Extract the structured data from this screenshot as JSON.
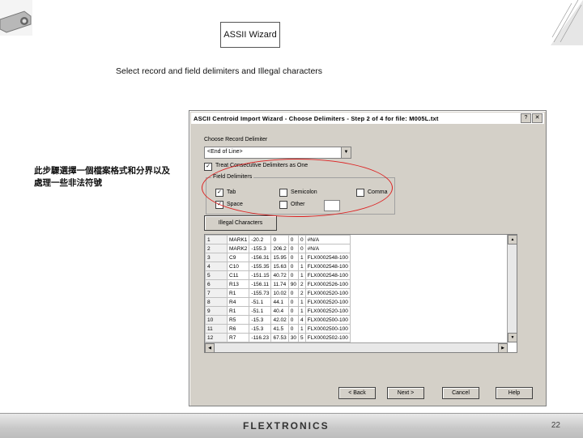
{
  "slide": {
    "title": "ASSII Wizard",
    "subtitle": "Select record and field delimiters and Illegal characters",
    "annotation": "此步驟選擇一個檔案格式和分界以及處理一些非法符號",
    "footer_logo": "FLEXTRONICS",
    "page_number": "22",
    "highlight_color": "#dd2222"
  },
  "dialog": {
    "title": "ASCII Centroid Import Wizard - Choose Delimiters - Step 2 of 4 for file: M005L.txt",
    "help_btn": "?",
    "close_btn": "✕",
    "record_delimiter_label": "Choose Record Delimiter",
    "record_delimiter_value": "<End of Line>",
    "treat_consecutive_label": "Treat Consecutive Delimiters as One",
    "treat_consecutive_checked": "✓",
    "field_delimiters_label": "Field Delimiters",
    "delims": {
      "tab": {
        "label": "Tab",
        "mark": "✓"
      },
      "semicolon": {
        "label": "Semicolon",
        "mark": ""
      },
      "comma": {
        "label": "Comma",
        "mark": ""
      },
      "space": {
        "label": "Space",
        "mark": "✓"
      },
      "other": {
        "label": "Other",
        "mark": ""
      }
    },
    "illegal_chars_btn": "Illegal Characters",
    "table": {
      "rows": [
        [
          "1",
          "MARK1",
          "-20.2",
          "0",
          "0",
          "0",
          "#N/A"
        ],
        [
          "2",
          "MARK2",
          "-155.3",
          "206.2",
          "0",
          "0",
          "#N/A"
        ],
        [
          "3",
          "C9",
          "-156.31",
          "15.95",
          "0",
          "1",
          "FLX0002548-100"
        ],
        [
          "4",
          "C10",
          "-155.35",
          "15.63",
          "0",
          "1",
          "FLX0002548-100"
        ],
        [
          "5",
          "C11",
          "-151.15",
          "40.72",
          "0",
          "1",
          "FLX0002548-100"
        ],
        [
          "6",
          "R13",
          "-156.11",
          "11.74",
          "90",
          "2",
          "FLX0002526-100"
        ],
        [
          "7",
          "R1",
          "-155.73",
          "10.02",
          "0",
          "2",
          "FLX0002520-100"
        ],
        [
          "8",
          "R4",
          "-51.1",
          "44.1",
          "0",
          "1",
          "FLX0002520-100"
        ],
        [
          "9",
          "R1",
          "-51.1",
          "40.4",
          "0",
          "1",
          "FLX0002520-100"
        ],
        [
          "10",
          "R5",
          "-15.3",
          "42.02",
          "0",
          "4",
          "FLX0002500-100"
        ],
        [
          "11",
          "R6",
          "-15.3",
          "41.5",
          "0",
          "1",
          "FLX0002500-100"
        ],
        [
          "12",
          "R7",
          "-116.23",
          "67.53",
          "30",
          "5",
          "FLX0002502-100"
        ]
      ]
    },
    "buttons": {
      "back": "< Back",
      "next": "Next >",
      "cancel": "Cancel",
      "help": "Help"
    }
  }
}
